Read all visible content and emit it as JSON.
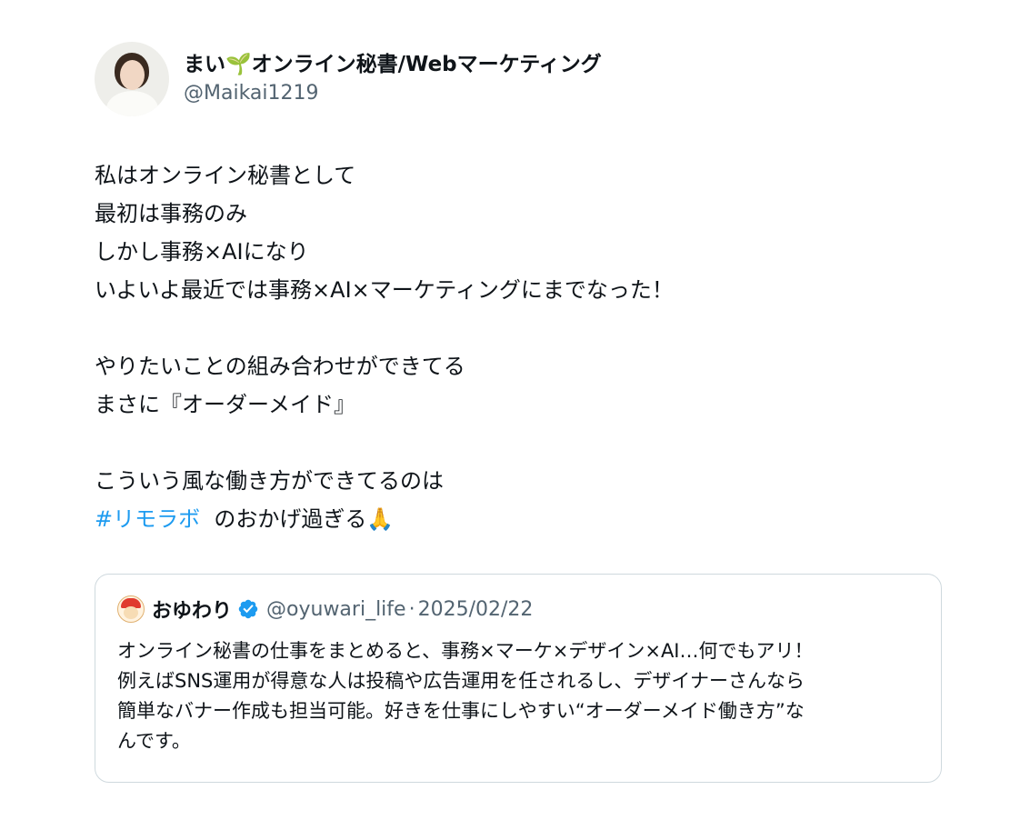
{
  "author": {
    "display_name": "まい🌱オンライン秘書/Webマーケティング",
    "handle": "@Maikai1219"
  },
  "post": {
    "lines": [
      "私はオンライン秘書として",
      "最初は事務のみ",
      "しかし事務×AIになり",
      "いよいよ最近では事務×AI×マーケティングにまでなった！",
      "",
      "やりたいことの組み合わせができてる",
      "まさに『オーダーメイド』",
      "",
      "こういう風な働き方ができてるのは"
    ],
    "hashtag": "#リモラボ",
    "last_line_rest": "のおかげ過ぎる🙏"
  },
  "quoted": {
    "name": "おゆわり",
    "handle": "@oyuwari_life",
    "separator": "·",
    "date": "2025/02/22",
    "lines": [
      "オンライン秘書の仕事をまとめると、事務×マーケ×デザイン×AI…何でもアリ！",
      "例えばSNS運用が得意な人は投稿や広告運用を任されるし、デザイナーさんなら",
      "簡単なバナー作成も担当可能。好きを仕事にしやすい“オーダーメイド働き方”な",
      "んです。"
    ]
  },
  "colors": {
    "text": "#0f1419",
    "secondary": "#536471",
    "link": "#1d9bf0",
    "border": "#cfd9de",
    "verified": "#1d9bf0"
  },
  "icons": {
    "verified": "verified-badge-icon"
  }
}
